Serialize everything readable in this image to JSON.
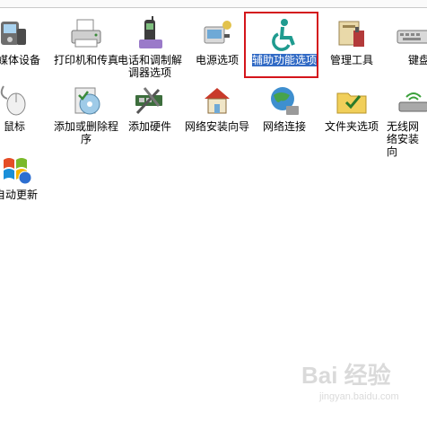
{
  "row1": [
    {
      "label": "携媒体设备",
      "icon": "portable-device-icon"
    },
    {
      "label": "打印机和传真",
      "icon": "printer-icon"
    },
    {
      "label": "电话和调制解调器选项",
      "icon": "phone-modem-icon"
    },
    {
      "label": "电源选项",
      "icon": "power-options-icon"
    },
    {
      "label": "辅助功能选项",
      "icon": "accessibility-icon"
    },
    {
      "label": "管理工具",
      "icon": "admin-tools-icon"
    },
    {
      "label": "键盘",
      "icon": "keyboard-icon"
    }
  ],
  "row2": [
    {
      "label": "鼠标",
      "icon": "mouse-icon"
    },
    {
      "label": "添加或删除程序",
      "icon": "add-remove-programs-icon"
    },
    {
      "label": "添加硬件",
      "icon": "add-hardware-icon"
    },
    {
      "label": "网络安装向导",
      "icon": "network-setup-wizard-icon"
    },
    {
      "label": "网络连接",
      "icon": "network-connections-icon"
    },
    {
      "label": "文件夹选项",
      "icon": "folder-options-icon"
    },
    {
      "label": "无线网络安装向",
      "icon": "wireless-network-icon"
    }
  ],
  "row3": [
    {
      "label": "自动更新",
      "icon": "automatic-updates-icon"
    }
  ],
  "selected_item": "辅助功能选项",
  "highlight_color": "#d4151b",
  "selection_color": "#316ac5",
  "watermark": {
    "brand": "Bai 经验",
    "url": "jingyan.baidu.com"
  }
}
